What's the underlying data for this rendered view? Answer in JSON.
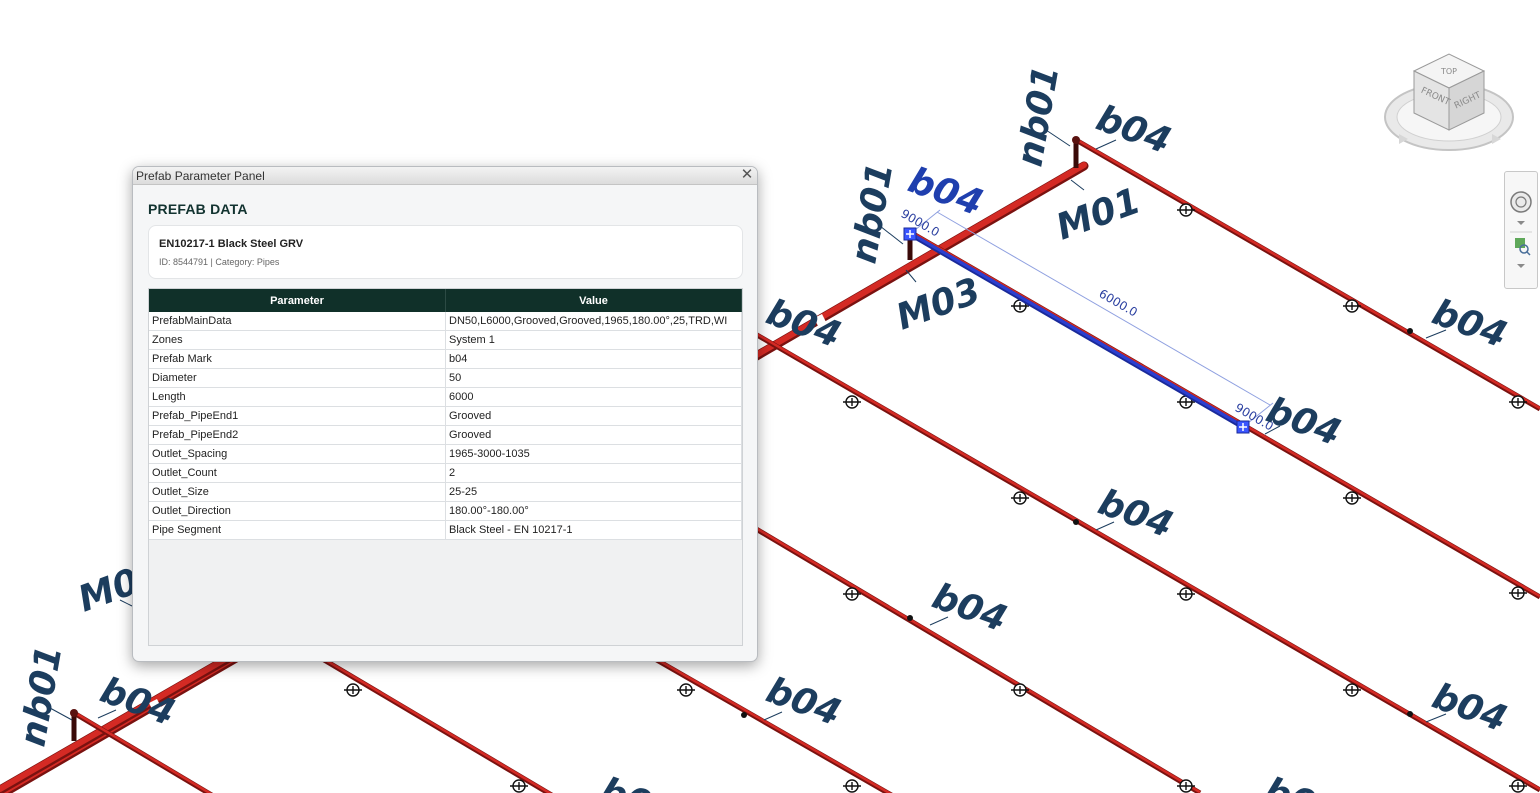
{
  "panel": {
    "title": "Prefab Parameter Panel",
    "close_glyph": "✕",
    "heading": "PREFAB DATA",
    "element_title": "EN10217-1 Black Steel GRV",
    "element_sub": "ID: 8544791 | Category: Pipes",
    "columns": [
      "Parameter",
      "Value"
    ],
    "rows": [
      {
        "param": "PrefabMainData",
        "value": "DN50,L6000,Grooved,Grooved,1965,180.00°,25,TRD,WI"
      },
      {
        "param": "Zones",
        "value": "System 1"
      },
      {
        "param": "Prefab Mark",
        "value": "b04"
      },
      {
        "param": "Diameter",
        "value": "50"
      },
      {
        "param": "Length",
        "value": "6000"
      },
      {
        "param": "Prefab_PipeEnd1",
        "value": "Grooved"
      },
      {
        "param": "Prefab_PipeEnd2",
        "value": "Grooved"
      },
      {
        "param": "Outlet_Spacing",
        "value": "1965-3000-1035"
      },
      {
        "param": "Outlet_Count",
        "value": "2"
      },
      {
        "param": "Outlet_Size",
        "value": "25-25"
      },
      {
        "param": "Outlet_Direction",
        "value": "180.00°-180.00°"
      },
      {
        "param": "Pipe Segment",
        "value": "Black Steel - EN 10217-1"
      }
    ]
  },
  "viewport": {
    "tags": {
      "b04": "b04",
      "nb01": "nb01",
      "m01": "M01",
      "m03": "M03",
      "b0_partial": "b0"
    },
    "dimensions": {
      "length": "6000.0",
      "offset": "9000.0"
    }
  },
  "viewcube": {
    "top": "TOP",
    "front": "FRONT",
    "right": "RIGHT"
  },
  "colors": {
    "pipe": "#d42a24",
    "pipe_dark": "#7a1210",
    "selected": "#2b3fd0",
    "tag": "#1c3d5e",
    "panel_header": "#103029"
  },
  "icons": [
    "close-icon",
    "wheel-icon",
    "zoom-icon",
    "chevron-down-icon",
    "viewcube-icon"
  ]
}
